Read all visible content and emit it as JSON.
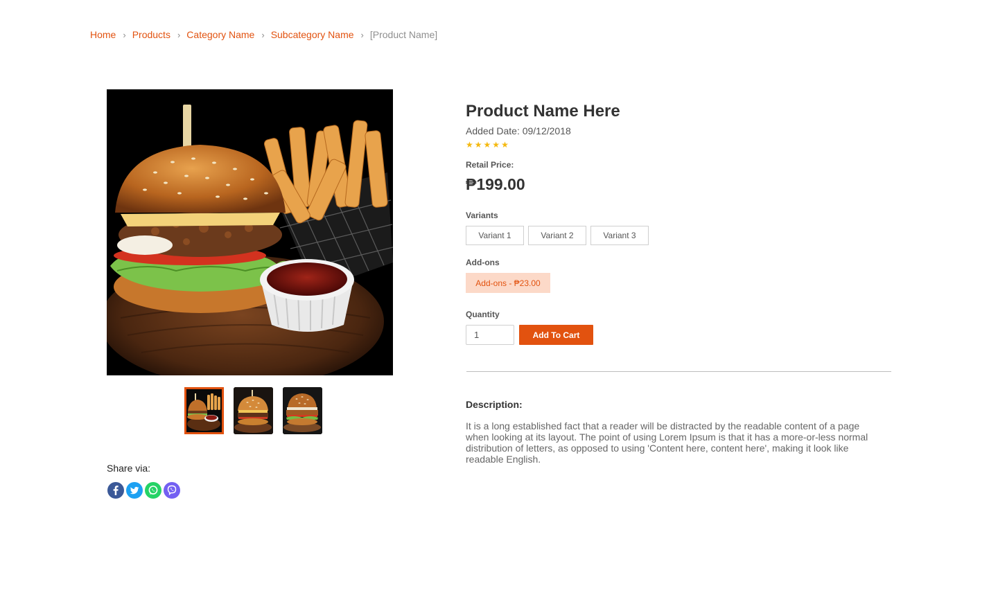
{
  "breadcrumb": {
    "home": "Home",
    "products": "Products",
    "category": "Category Name",
    "subcategory": "Subcategory Name",
    "current": "[Product Name]",
    "separator": "›"
  },
  "gallery": {
    "main_image": "burger-with-fries-photo",
    "thumbnails": [
      "burger-with-fries-thumb",
      "burger-thumb",
      "chicken-burger-thumb"
    ],
    "active_thumbnail": 0
  },
  "share": {
    "label": "Share via:",
    "icons": [
      "facebook-icon",
      "twitter-icon",
      "whatsapp-icon",
      "viber-icon"
    ]
  },
  "product": {
    "name": "Product Name Here",
    "added_date": "Added Date: 09/12/2018",
    "rating": 5,
    "retail_label": "Retail Price:",
    "price": "₱199.00"
  },
  "variants": {
    "label": "Variants",
    "options": [
      "Variant 1",
      "Variant 2",
      "Variant 3"
    ]
  },
  "addons": {
    "label": "Add-ons",
    "option": "Add-ons - ₱23.00"
  },
  "quantity": {
    "label": "Quantity",
    "value": "1",
    "add_to_cart": "Add To Cart"
  },
  "description": {
    "label": "Description:",
    "text": "It is a long established fact that a reader will be distracted by the readable content of a page when looking at its layout. The point of  using Lorem Ipsum is that it has a more-or-less normal distribution of letters, as opposed to using 'Content here, content here',  making it look like readable English."
  },
  "colors": {
    "accent": "#e2520f",
    "addon_bg": "#fcd9c8",
    "star": "#f5b90f",
    "facebook": "#3b5998",
    "twitter": "#1da1f2",
    "whatsapp": "#25d366",
    "viber": "#7360f2"
  }
}
